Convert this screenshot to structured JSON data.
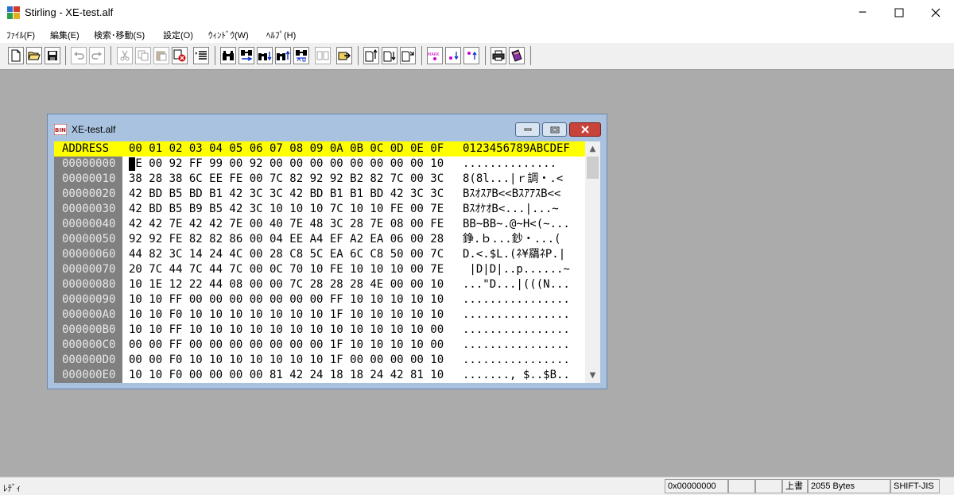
{
  "window": {
    "title": "Stirling - XE-test.alf"
  },
  "menu": [
    "ﾌｧｲﾙ(F)",
    "編集(E)",
    "検索･移動(S)",
    "設定(O)",
    "ｳｨﾝﾄﾞｳ(W)",
    "ﾍﾙﾌﾟ(H)"
  ],
  "toolbar": {
    "groups": [
      [
        "new-file",
        "open-folder",
        "save"
      ],
      [
        "undo",
        "redo"
      ],
      [
        "cut",
        "copy",
        "paste",
        "delete",
        "select-list"
      ],
      [
        "find",
        "find-replace",
        "find-down",
        "find-up",
        "find-compare",
        "binary-compare",
        "jump"
      ],
      [
        "insert-file",
        "write-block",
        "write-block-down"
      ],
      [
        "mark",
        "mark-prev",
        "mark-next"
      ],
      [
        "print",
        "book"
      ]
    ]
  },
  "document": {
    "title": "XE-test.alf",
    "header": {
      "address_label": "ADDRESS",
      "columns": "00 01 02 03 04 05 06 07 08 09 0A 0B 0C 0D 0E 0F",
      "ascii_label": "0123456789ABCDEF"
    },
    "rows": [
      {
        "addr": "00000000",
        "hex": "FE 00 92 FF 99 00 92 00 00 00 00 00 00 00 00 10",
        "ascii": ".............. "
      },
      {
        "addr": "00000010",
        "hex": "38 28 38 6C EE FE 00 7C 82 92 92 B2 82 7C 00 3C",
        "ascii": "8(8l...|ｒ調・.<"
      },
      {
        "addr": "00000020",
        "hex": "42 BD B5 BD B1 42 3C 3C 42 BD B1 B1 BD 42 3C 3C",
        "ascii": "BｽｵｽｱB<<BｽｱｱｽB<<"
      },
      {
        "addr": "00000030",
        "hex": "42 BD B5 B9 B5 42 3C 10 10 10 7C 10 10 FE 00 7E",
        "ascii": "BｽｵｹｵB<...|...~"
      },
      {
        "addr": "00000040",
        "hex": "42 42 7E 42 42 7E 00 40 7E 48 3C 28 7E 08 00 FE",
        "ascii": "BB~BB~.@~H<(~..."
      },
      {
        "addr": "00000050",
        "hex": "92 92 FE 82 82 86 00 04 EE A4 EF A2 EA 06 00 28",
        "ascii": "錚.ｂ...鈔・...("
      },
      {
        "addr": "00000060",
        "hex": "44 82 3C 14 24 4C 00 28 C8 5C EA 6C C8 50 00 7C",
        "ascii": "D.<.$L.(ﾈ¥羂ﾈP.|"
      },
      {
        "addr": "00000070",
        "hex": "20 7C 44 7C 44 7C 00 0C 70 10 FE 10 10 10 00 7E",
        "ascii": " |D|D|..p......~"
      },
      {
        "addr": "00000080",
        "hex": "10 1E 12 22 44 08 00 00 7C 28 28 28 4E 00 00 10",
        "ascii": "...\"D...|(((N..."
      },
      {
        "addr": "00000090",
        "hex": "10 10 FF 00 00 00 00 00 00 00 FF 10 10 10 10 10",
        "ascii": "................"
      },
      {
        "addr": "000000A0",
        "hex": "10 10 F0 10 10 10 10 10 10 10 1F 10 10 10 10 10",
        "ascii": "................"
      },
      {
        "addr": "000000B0",
        "hex": "10 10 FF 10 10 10 10 10 10 10 10 10 10 10 10 00",
        "ascii": "................"
      },
      {
        "addr": "000000C0",
        "hex": "00 00 FF 00 00 00 00 00 00 00 1F 10 10 10 10 00",
        "ascii": "................"
      },
      {
        "addr": "000000D0",
        "hex": "00 00 F0 10 10 10 10 10 10 10 1F 00 00 00 00 10",
        "ascii": "................"
      },
      {
        "addr": "000000E0",
        "hex": "10 10 F0 00 00 00 00 81 42 24 18 18 24 42 81 10",
        "ascii": "......., $..$B.."
      }
    ]
  },
  "status": {
    "left": "ﾚﾃﾞｨ",
    "offset": "0x00000000",
    "mode": "上書",
    "size": "2055 Bytes",
    "encoding": "SHIFT-JIS"
  }
}
